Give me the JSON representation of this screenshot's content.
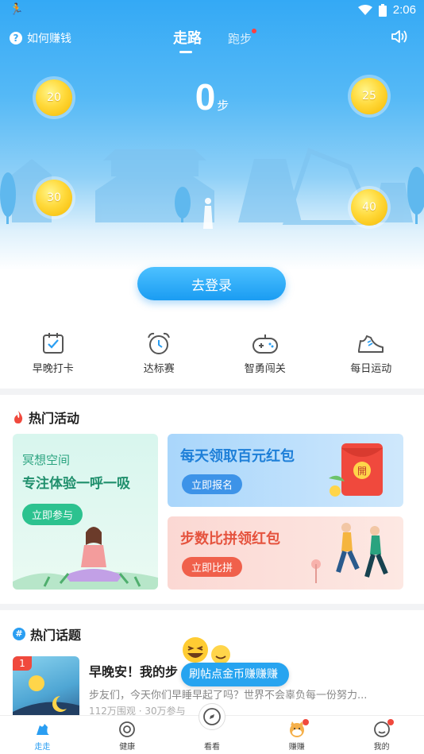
{
  "status_bar": {
    "time": "2:06"
  },
  "header": {
    "help_label": "如何赚钱",
    "tabs": [
      {
        "label": "走路",
        "active": true
      },
      {
        "label": "跑步",
        "active": false,
        "has_dot": true
      }
    ]
  },
  "steps": {
    "count": "0",
    "unit": "步"
  },
  "coins": [
    "20",
    "25",
    "30",
    "40"
  ],
  "login_button": "去登录",
  "features": [
    {
      "label": "早晚打卡",
      "icon": "checkin-icon"
    },
    {
      "label": "达标赛",
      "icon": "alarm-clock-icon"
    },
    {
      "label": "智勇闯关",
      "icon": "gamepad-icon"
    },
    {
      "label": "每日运动",
      "icon": "sneaker-icon"
    }
  ],
  "activities": {
    "title": "热门活动",
    "cards": [
      {
        "line1": "冥想空间",
        "line2": "专注体验一呼一吸",
        "button": "立即参与"
      },
      {
        "line1": "每天领取百元红包",
        "button": "立即报名",
        "badge": "開"
      },
      {
        "line1": "步数比拼领红包",
        "button": "立即比拼"
      }
    ]
  },
  "topics": {
    "title": "热门话题",
    "items": [
      {
        "rank": "1",
        "title": "早晚安！我的步",
        "desc": "步友们，今天你们早睡早起了吗？世界不会辜负每一份努力...",
        "meta": "112万围观 · 30万参与"
      }
    ]
  },
  "promo_label": "刷帖点金币赚赚赚",
  "bottom_nav": [
    {
      "label": "走走",
      "icon": "walk-icon",
      "active": true
    },
    {
      "label": "健康",
      "icon": "health-icon",
      "active": false
    },
    {
      "label": "看看",
      "icon": "compass-icon",
      "active": false
    },
    {
      "label": "赚赚",
      "icon": "dog-icon",
      "active": false,
      "has_dot": true
    },
    {
      "label": "我的",
      "icon": "profile-icon",
      "active": false,
      "has_dot": true
    }
  ],
  "colors": {
    "primary": "#2a9ef2",
    "accent_red": "#f0493d",
    "coin": "#ffd93a"
  }
}
